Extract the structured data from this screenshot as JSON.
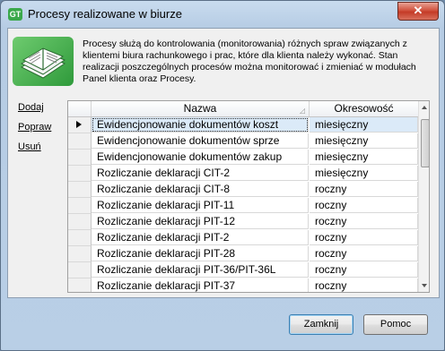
{
  "window": {
    "title": "Procesy realizowane w biurze",
    "close_label": "✕",
    "app_icon_text": "GT"
  },
  "info": {
    "text": "Procesy służą do kontrolowania (monitorowania) różnych spraw związanych z klientemi biura rachunkowego i prac, które dla klienta należy wykonać. Stan realizacji poszczególnych procesów można monitorować i zmieniać w modułach Panel klienta oraz Procesy."
  },
  "side_actions": {
    "add": "Dodaj",
    "edit": "Popraw",
    "delete": "Usuń"
  },
  "table": {
    "columns": [
      "Nazwa",
      "Okresowość"
    ],
    "rows": [
      {
        "name": "Ewidencjonowanie dokumentów koszt",
        "period": "miesięczny"
      },
      {
        "name": "Ewidencjonowanie dokumentów sprze",
        "period": "miesięczny"
      },
      {
        "name": "Ewidencjonowanie dokumentów zakup",
        "period": "miesięczny"
      },
      {
        "name": "Rozliczanie deklaracji CIT-2",
        "period": "miesięczny"
      },
      {
        "name": "Rozliczanie deklaracji CIT-8",
        "period": "roczny"
      },
      {
        "name": "Rozliczanie deklaracji PIT-11",
        "period": "roczny"
      },
      {
        "name": "Rozliczanie deklaracji PIT-12",
        "period": "roczny"
      },
      {
        "name": "Rozliczanie deklaracji PIT-2",
        "period": "roczny"
      },
      {
        "name": "Rozliczanie deklaracji PIT-28",
        "period": "roczny"
      },
      {
        "name": "Rozliczanie deklaracji PIT-36/PIT-36L",
        "period": "roczny"
      },
      {
        "name": "Rozliczanie deklaracji PIT-37",
        "period": "roczny"
      }
    ],
    "selected_row": 0
  },
  "buttons": {
    "close": "Zamknij",
    "help": "Pomoc"
  }
}
